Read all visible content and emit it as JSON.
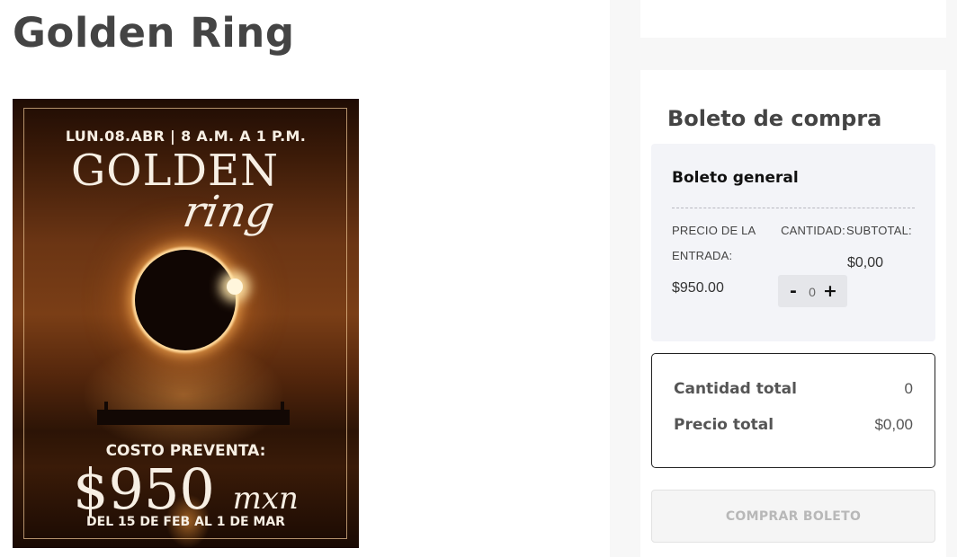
{
  "page": {
    "title": "Golden Ring"
  },
  "poster": {
    "date_line": "LUN.08.ABR | 8 A.M. A 1 P.M.",
    "title_main": "GOLDEN",
    "title_script": "ring",
    "presale_label": "COSTO PREVENTA:",
    "presale_price": "$950",
    "presale_currency": "mxn",
    "presale_dates": "DEL 15 DE FEB AL 1 DE MAR"
  },
  "purchase": {
    "section_title": "Boleto de compra",
    "ticket": {
      "name": "Boleto general",
      "price_label": "PRECIO DE LA ENTRADA:",
      "quantity_label": "CANTIDAD:",
      "subtotal_label": "SUBTOTAL:",
      "price_value": "$950.00",
      "subtotal_value": "$0,00",
      "quantity_value": "0",
      "minus_label": "-",
      "plus_label": "+"
    },
    "totals": {
      "quantity_label": "Cantidad total",
      "quantity_value": "0",
      "price_label": "Precio total",
      "price_value": "$0,00"
    },
    "buy_button_label": "COMPRAR BOLETO"
  }
}
